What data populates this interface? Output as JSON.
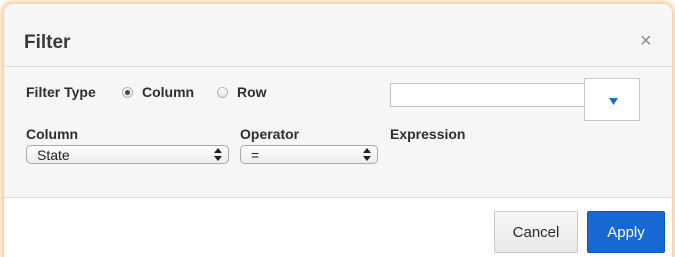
{
  "dialog": {
    "title": "Filter",
    "close_glyph": "×"
  },
  "filter_type": {
    "label": "Filter Type",
    "options": [
      {
        "label": "Column",
        "selected": true
      },
      {
        "label": "Row",
        "selected": false
      }
    ]
  },
  "fields": {
    "column": {
      "label": "Column",
      "value": "State"
    },
    "operator": {
      "label": "Operator",
      "value": "="
    },
    "expression": {
      "label": "Expression",
      "value": ""
    }
  },
  "footer": {
    "cancel_label": "Cancel",
    "apply_label": "Apply"
  },
  "colors": {
    "accent": "#1769d1",
    "glow": "#f9c99a",
    "dropdown_arrow": "#1f6fbf"
  },
  "icons": {
    "close": "close-icon",
    "select_arrows": "updown-arrows-icon",
    "dropdown": "caret-down-icon"
  }
}
